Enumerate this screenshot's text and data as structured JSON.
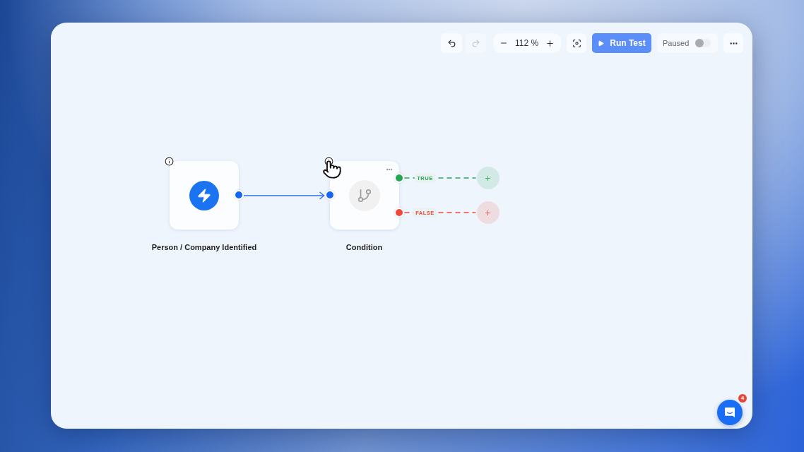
{
  "toolbar": {
    "undo": {
      "disabled": false
    },
    "redo": {
      "disabled": true
    },
    "zoom": {
      "value": "112 %"
    },
    "run_button": {
      "label": "Run Test"
    },
    "pause_switch": {
      "label": "Paused",
      "on": false
    }
  },
  "nodes": [
    {
      "kind": "trigger",
      "label": "Person / Company Identified"
    },
    {
      "kind": "condition",
      "label": "Condition",
      "branches": [
        {
          "label": "TRUE",
          "color": "#27a654"
        },
        {
          "label": "FALSE",
          "color": "#f0483a"
        }
      ]
    }
  ],
  "chat_launcher": {
    "badge": "4"
  }
}
